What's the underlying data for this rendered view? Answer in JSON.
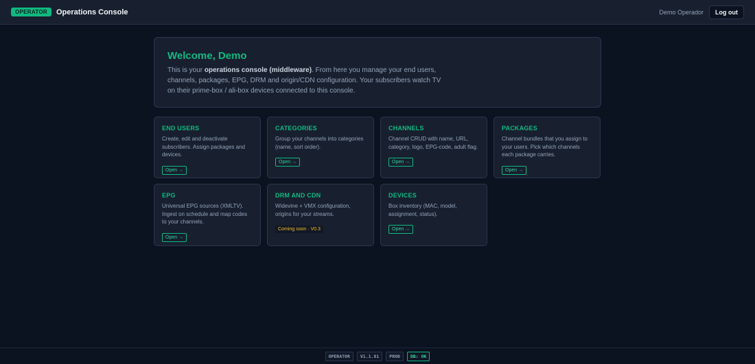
{
  "header": {
    "role_badge": "OPERATOR",
    "title": "Operations Console",
    "user": "Demo Operador",
    "logout_label": "Log out"
  },
  "welcome": {
    "heading": "Welcome, Demo",
    "text_before": "This is your ",
    "text_bold": "operations console (middleware)",
    "text_after": ". From here you manage your end users, channels, packages, EPG, DRM and origin/CDN configuration. Your subscribers watch TV on their prime-box / ali-box devices connected to this console."
  },
  "cards": [
    {
      "title": "End users",
      "description": "Create, edit and deactivate subscribers. Assign packages and devices.",
      "action": "Open →"
    },
    {
      "title": "Categories",
      "description": "Group your channels into categories (name, sort order).",
      "action": "Open →"
    },
    {
      "title": "Channels",
      "description": "Channel CRUD with name, URL, category, logo, EPG-code, adult flag.",
      "action": "Open →"
    },
    {
      "title": "Packages",
      "description": "Channel bundles that you assign to your users. Pick which channels each package carries.",
      "action": "Open →"
    },
    {
      "title": "EPG",
      "description": "Universal EPG sources (XMLTV). Ingest on schedule and map codes to your channels.",
      "action": "Open →"
    },
    {
      "title": "DRM and CDN",
      "description": "Widevine + VMX configuration, origins for your streams.",
      "status": "Coming soon · V0.3"
    },
    {
      "title": "Devices",
      "description": "Box inventory (MAC, model, assignment, status).",
      "action": "Open →"
    }
  ],
  "footer": {
    "role": "OPERATOR",
    "version": "V1.1.81",
    "env": "PROD",
    "db_status": "DB: OK"
  },
  "colors": {
    "accent": "#10b981",
    "background": "#0b1220",
    "card": "#18202f",
    "warning": "#fbbf24"
  }
}
